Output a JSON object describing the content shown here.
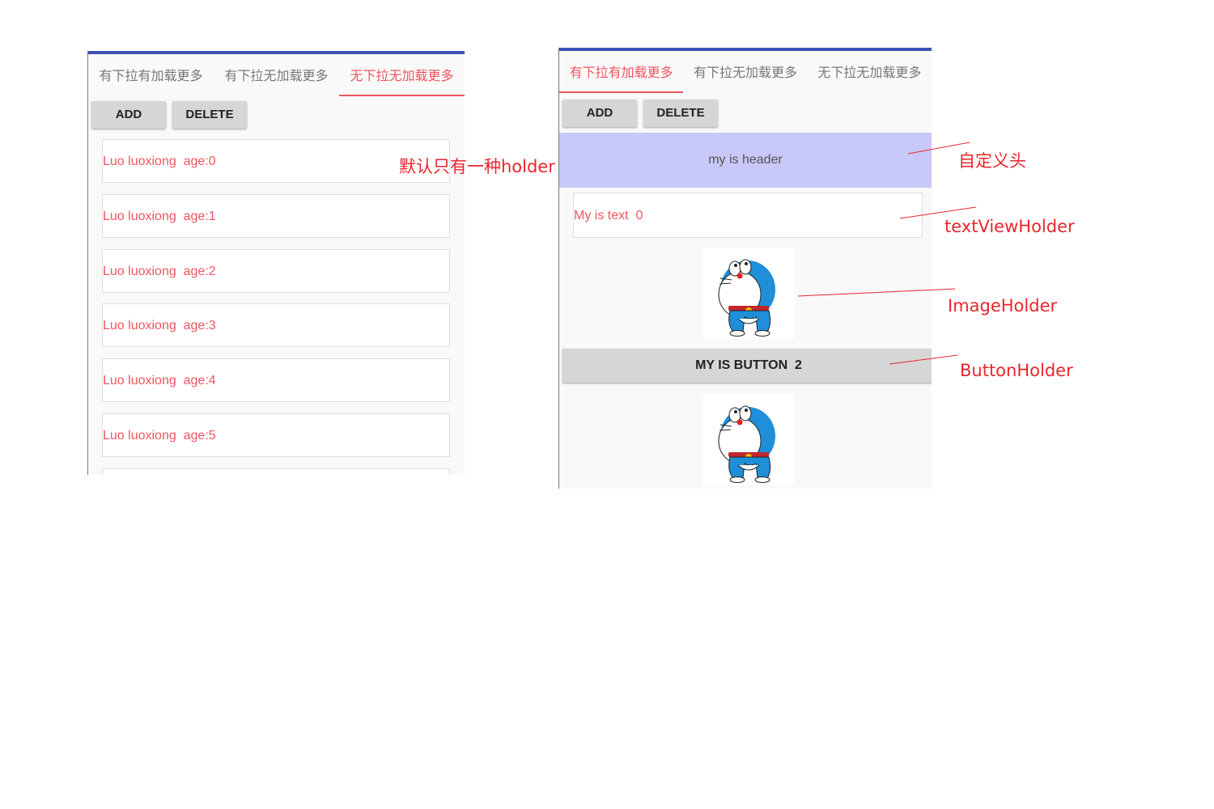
{
  "left_screen": {
    "tabs": [
      {
        "label": "有下拉有加载更多",
        "active": false
      },
      {
        "label": "有下拉无加载更多",
        "active": false
      },
      {
        "label": "无下拉无加载更多",
        "active": true
      }
    ],
    "buttons": {
      "add": "ADD",
      "delete": "DELETE"
    },
    "items": [
      "Luo luoxiong  age:0",
      "Luo luoxiong  age:1",
      "Luo luoxiong  age:2",
      "Luo luoxiong  age:3",
      "Luo luoxiong  age:4",
      "Luo luoxiong  age:5"
    ]
  },
  "right_screen": {
    "tabs": [
      {
        "label": "有下拉有加载更多",
        "active": true
      },
      {
        "label": "有下拉无加载更多",
        "active": false
      },
      {
        "label": "无下拉无加载更多",
        "active": false
      }
    ],
    "buttons": {
      "add": "ADD",
      "delete": "DELETE"
    },
    "header_text": "my is header",
    "text_item": "My is text  0",
    "image_icon": "doraemon-icon",
    "button_item": "MY IS BUTTON  2"
  },
  "annotations": {
    "default_holder": "默认只有一种holder",
    "custom_header": "自定义头",
    "text_view_holder": "textViewHolder",
    "image_holder": "ImageHolder",
    "button_holder": "ButtonHolder"
  },
  "colors": {
    "accent": "#ee5560",
    "top_bar": "#3f51b5",
    "header_bg": "#c8c8fa",
    "annotation": "#e8262d"
  }
}
